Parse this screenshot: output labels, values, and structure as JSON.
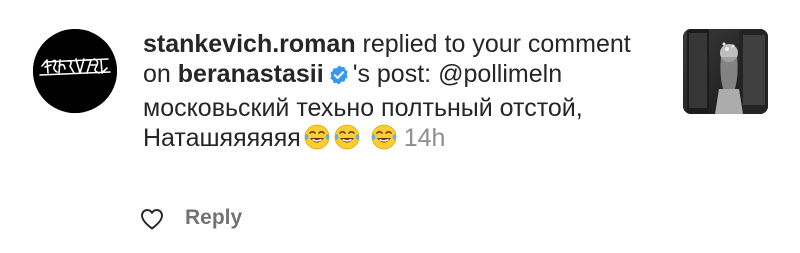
{
  "notification": {
    "username": "stankevich.roman",
    "action_text": " replied to your comment on ",
    "post_owner": "beranastasii",
    "post_suffix": "'s post:",
    "reply_text": "@pollimeln московьский техьно полтьный отстой, Наташяяяяяя",
    "emoji": "face-with-tears-of-joy",
    "emoji_count": 3,
    "time": "14h",
    "avatar_icon": "graffiti-logo-avatar",
    "verified_icon": "verified-badge-icon",
    "verified_color": "#3897f0",
    "thumbnail_icon": "post-thumbnail-photo"
  },
  "actions": {
    "like_icon": "heart-outline-icon",
    "reply_label": "Reply"
  },
  "colors": {
    "text": "#262626",
    "secondary": "#8e8e8e",
    "reply": "#737373",
    "background": "#ffffff"
  }
}
